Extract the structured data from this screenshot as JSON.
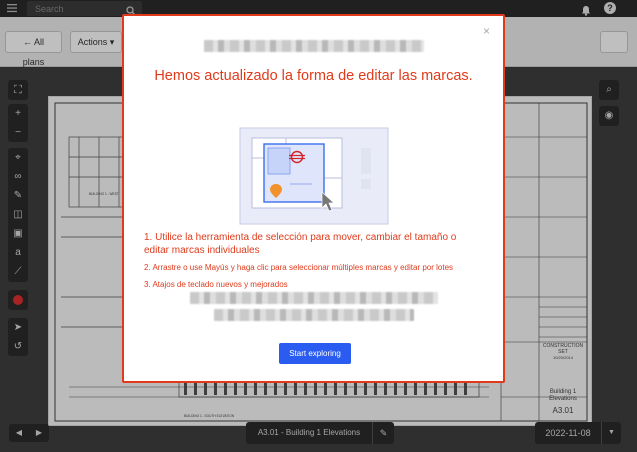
{
  "topbar": {
    "search": {
      "placeholder": "Search"
    }
  },
  "toolbar": {
    "all_plans_label": "← All plans",
    "actions_label": "Actions ▾"
  },
  "drawing": {
    "sheet_number": "A3.01",
    "sheet_label": "A3.01 - Building 1 Elevations",
    "title_block_lines": [
      "CONSTRUCTION",
      "SET",
      "10/20/2014"
    ],
    "title_block_name": [
      "Building 1",
      "Elevations"
    ],
    "title_block_number": "A3.01",
    "callouts": [
      "BUILDING 1 - WEST",
      "BUILDING 1 - SOUTH ELEVATION"
    ]
  },
  "bottombar": {
    "date": "2022-11-08"
  },
  "modal": {
    "title": "Hemos actualizado la forma de editar las marcas.",
    "items": [
      "1. Utilice la herramienta de selección para mover, cambiar el tamaño o editar marcas individuales",
      "2. Arrastre o use Mayús y haga clic para seleccionar múltiples marcas y editar por lotes",
      "3. Atajos de teclado nuevos y mejorados"
    ],
    "start_label": "Start exploring",
    "close_glyph": "×"
  },
  "icons": {
    "menu": "menu-icon",
    "search": "search-icon",
    "bell": "bell-icon",
    "help": "help-icon",
    "help_glyph": "?"
  },
  "colors": {
    "accent": "#e03a1a",
    "primary_button": "#2a5cf2",
    "record": "#e03131"
  }
}
